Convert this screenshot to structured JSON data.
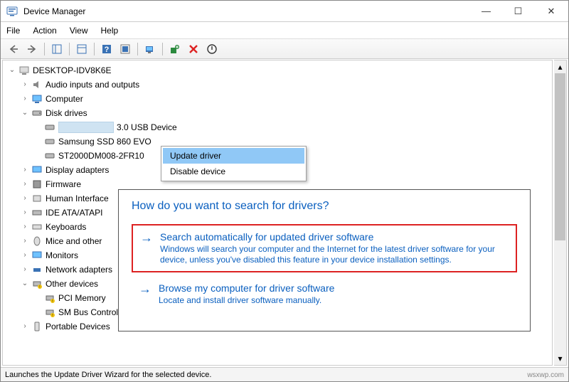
{
  "window": {
    "title": "Device Manager"
  },
  "titlectrls": {
    "min": "—",
    "max": "☐",
    "close": "✕"
  },
  "menubar": [
    "File",
    "Action",
    "View",
    "Help"
  ],
  "tree": {
    "root": "DESKTOP-IDV8K6E",
    "items": [
      {
        "label": "Audio inputs and outputs"
      },
      {
        "label": "Computer"
      },
      {
        "label": "Disk drives"
      },
      {
        "label": "3.0 USB Device"
      },
      {
        "label": "Samsung SSD 860 EVO"
      },
      {
        "label": "ST2000DM008-2FR10"
      },
      {
        "label": "Display adapters"
      },
      {
        "label": "Firmware"
      },
      {
        "label": "Human Interface"
      },
      {
        "label": "IDE ATA/ATAPI"
      },
      {
        "label": "Keyboards"
      },
      {
        "label": "Mice and other"
      },
      {
        "label": "Monitors"
      },
      {
        "label": "Network adapters"
      },
      {
        "label": "Other devices"
      },
      {
        "label": "PCI Memory"
      },
      {
        "label": "SM Bus Controller"
      },
      {
        "label": "Portable Devices"
      }
    ]
  },
  "context_menu": {
    "items": [
      "Update driver",
      "Disable device"
    ]
  },
  "dialog": {
    "title": "How do you want to search for drivers?",
    "options": [
      {
        "title": "Search automatically for updated driver software",
        "desc": "Windows will search your computer and the Internet for the latest driver software for your device, unless you've disabled this feature in your device installation settings."
      },
      {
        "title": "Browse my computer for driver software",
        "desc": "Locate and install driver software manually."
      }
    ]
  },
  "statusbar": "Launches the Update Driver Wizard for the selected device.",
  "watermark": "wsxwp.com"
}
